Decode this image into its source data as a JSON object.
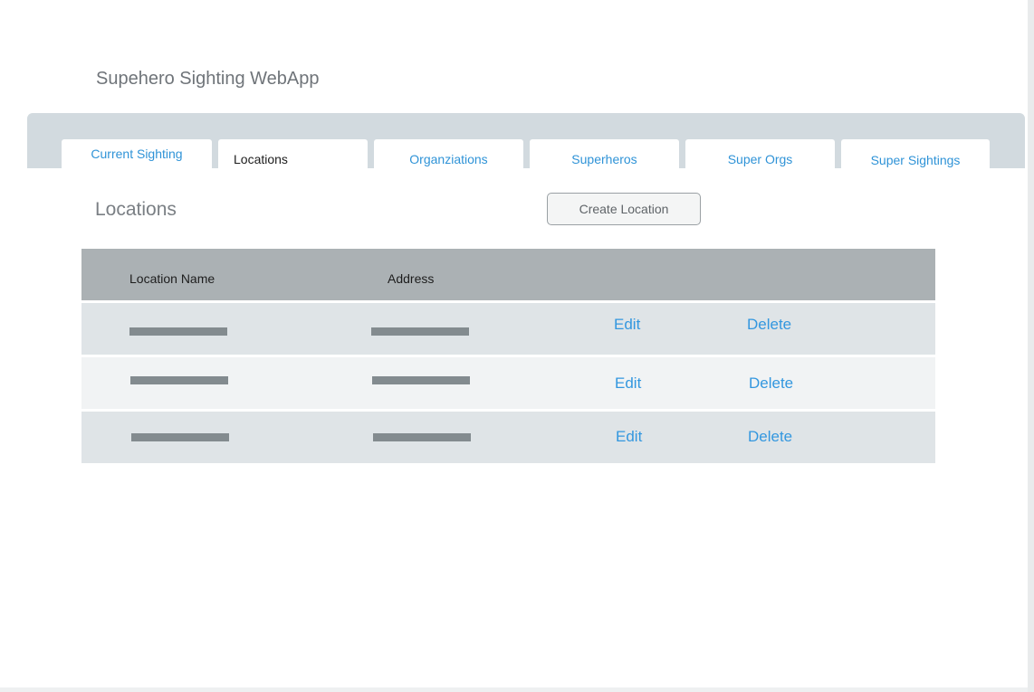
{
  "app": {
    "title": "Supehero Sighting WebApp"
  },
  "tabs": [
    {
      "label": "Current Sighting",
      "active": false
    },
    {
      "label": "Locations",
      "active": true
    },
    {
      "label": "Organziations",
      "active": false
    },
    {
      "label": "Superheros",
      "active": false
    },
    {
      "label": "Super Orgs",
      "active": false
    },
    {
      "label": "Super Sightings",
      "active": false
    }
  ],
  "page": {
    "title": "Locations",
    "create_button_label": "Create Location"
  },
  "table": {
    "columns": [
      "Location Name",
      "Address"
    ],
    "rows": [
      {
        "edit_label": "Edit",
        "delete_label": "Delete"
      },
      {
        "edit_label": "Edit",
        "delete_label": "Delete"
      },
      {
        "edit_label": "Edit",
        "delete_label": "Delete"
      }
    ]
  },
  "colors": {
    "link": "#3397df",
    "tab_strip": "#d2dadf",
    "table_header": "#abb1b4",
    "row_shaded": "#dfe4e7",
    "row_light": "#f1f3f4",
    "placeholder_bar": "#838b8f"
  }
}
